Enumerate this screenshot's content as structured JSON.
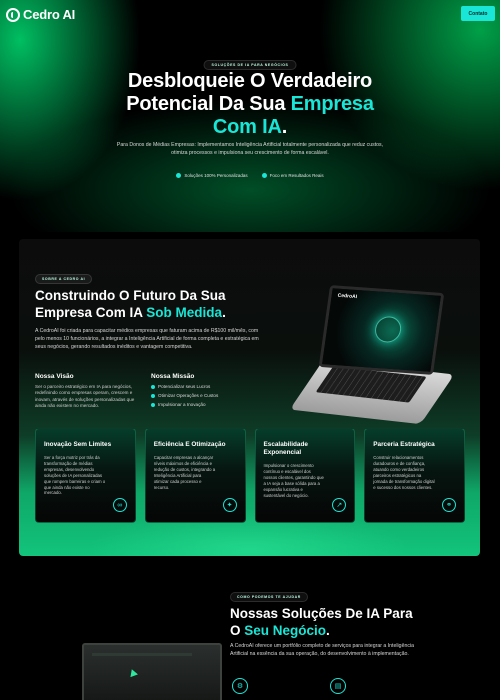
{
  "header": {
    "logo_text": "Cedro AI",
    "contact_label": "Contato"
  },
  "hero": {
    "tag": "SOLUÇÕES DE IA PARA NEGÓCIOS",
    "title_line1": "Desbloqueie O Verdadeiro",
    "title_line2_pre": "Potencial Da Sua ",
    "title_line2_accent": "Empresa",
    "title_line3_accent": "Com IA",
    "title_line3_post": ".",
    "description": "Para Donos de Médias Empresas: Implementamos Inteligência Artificial totalmente personalizada que reduz custos, otimiza processos e impulsiona seu crescimento de forma escalável.",
    "features": [
      "Soluções 100% Personalizadas",
      "Foco em Resultados Reais"
    ]
  },
  "about": {
    "tag": "SOBRE A CEDRO AI",
    "title_line1": "Construindo O Futuro Da Sua",
    "title_line2_pre": "Empresa Com IA ",
    "title_line2_accent": "Sob Medida",
    "title_line2_post": ".",
    "description": "A CedroAI foi criada para capacitar médios empresas que faturam acima de R$100 mil/mês, com pelo menos 10 funcionários, a integrar a Inteligência Artificial de forma completa e estratégica em seus negócios, gerando resultados inéditos e vantagem competitiva.",
    "vision_title": "Nossa Visão",
    "vision_text": "Ser o parceiro estratégico em IA para negócios, redefinindo como empresas operam, crescem e inovam, através de soluções personalizadas que ainda não existem no mercado.",
    "mission_title": "Nossa Missão",
    "mission_items": [
      "Potencializar seus Lucros",
      "Otimizar Operações e Custos",
      "Impulsionar a Inovação"
    ],
    "laptop_logo": "CedroAI",
    "cards": [
      {
        "title": "Inovação Sem Limites",
        "text": "Ser a força motriz por trás da transformação de médias empresas, desenvolvendo soluções de IA personalizadas que rompem barreiras e criam o que ainda não existe no mercado.",
        "icon": "infinity-icon"
      },
      {
        "title": "Eficiência E Otimização",
        "text": "Capacitar empresas a alcançar níveis máximos de eficiência e redução de custos, integrando a Inteligência Artificial para otimizar cada processo e recurso.",
        "icon": "sparkle-icon"
      },
      {
        "title": "Escalabilidade Exponencial",
        "text": "Impulsionar o crescimento contínuo e escalável dos nossos clientes, garantindo que a IA seja a base sólida para a expansão lucrativa e sustentável do negócio.",
        "icon": "growth-icon"
      },
      {
        "title": "Parceria Estratégica",
        "text": "Construir relacionamentos duradouros e de confiança, atuando como verdadeiros parceiros estratégicos na jornada de transformação digital e sucesso dos nossos clientes.",
        "icon": "handshake-icon"
      }
    ]
  },
  "solutions": {
    "tag": "COMO PODEMOS TE AJUDAR",
    "title_line1": "Nossas Soluções De IA Para",
    "title_line2_pre": "O ",
    "title_line2_accent": "Seu Negócio",
    "title_line2_post": ".",
    "description": "A CedroAI oferece um portfólio completo de serviços para integrar a Inteligência Artificial na essência da sua operação, do desenvolvimento à implementação."
  },
  "colors": {
    "accent": "#19e6d6",
    "green": "#12c47c",
    "background": "#000000"
  }
}
